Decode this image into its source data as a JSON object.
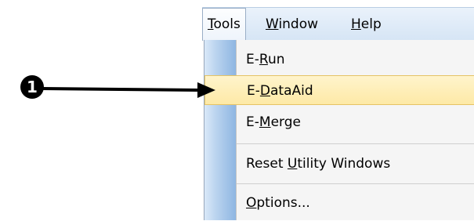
{
  "menubar": {
    "items": [
      {
        "label": "Tools",
        "access_key": "T",
        "active": true
      },
      {
        "label": "Window",
        "access_key": "W",
        "active": false
      },
      {
        "label": "Help",
        "access_key": "H",
        "active": false
      }
    ]
  },
  "tools_menu": {
    "items": [
      {
        "label": "E-Run",
        "access_key": "R",
        "highlighted": false
      },
      {
        "label": "E-DataAid",
        "access_key": "D",
        "highlighted": true
      },
      {
        "label": "E-Merge",
        "access_key": "M",
        "highlighted": false
      },
      {
        "label": "Reset Utility Windows",
        "access_key": "U",
        "highlighted": false
      },
      {
        "label": "Options...",
        "access_key": "O",
        "highlighted": false
      }
    ]
  },
  "callout": {
    "number": "1",
    "points_to": "E-DataAid"
  }
}
